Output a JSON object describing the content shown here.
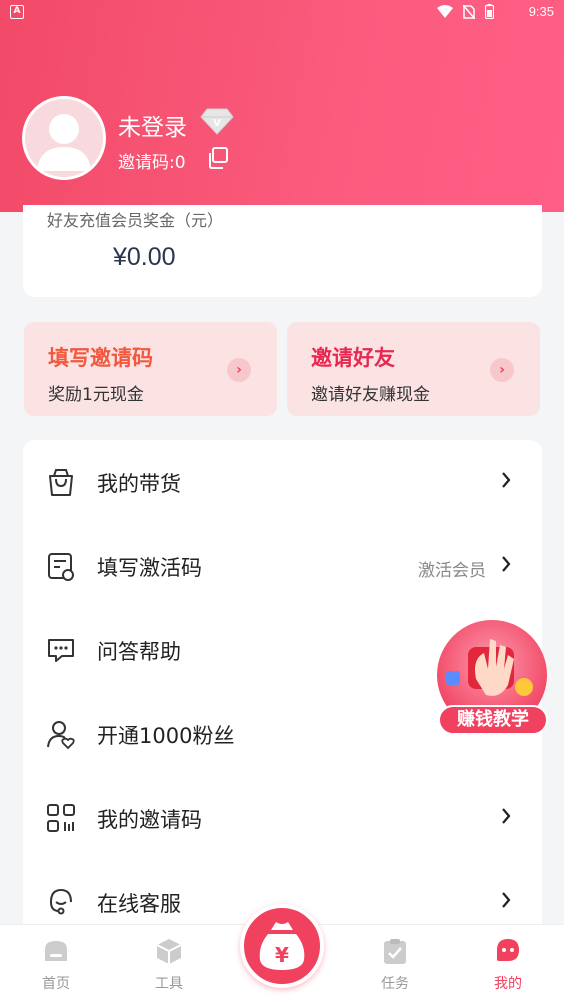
{
  "status_bar": {
    "time": "9:35",
    "app_badge": "A"
  },
  "profile": {
    "name": "未登录",
    "invite_code_label": "邀请码:0"
  },
  "earnings": {
    "label": "好友充值会员奖金（元）",
    "amount": "¥0.00"
  },
  "promos": [
    {
      "title": "填写邀请码",
      "subtitle": "奖励1元现金",
      "title_color": "#f2583e"
    },
    {
      "title": "邀请好友",
      "subtitle": "邀请好友赚现金",
      "title_color": "#e8284f"
    }
  ],
  "menu": [
    {
      "label": "我的带货",
      "icon": "shopping-bag-icon",
      "extra": ""
    },
    {
      "label": "填写激活码",
      "icon": "activation-form-icon",
      "extra": "激活会员"
    },
    {
      "label": "问答帮助",
      "icon": "chat-help-icon",
      "extra": ""
    },
    {
      "label": "开通1000粉丝",
      "icon": "user-heart-icon",
      "extra": ""
    },
    {
      "label": "我的邀请码",
      "icon": "qr-code-icon",
      "extra": ""
    },
    {
      "label": "在线客服",
      "icon": "customer-service-icon",
      "extra": ""
    }
  ],
  "floating_badge": {
    "label": "赚钱教学",
    "icon": "hand-gift-icon"
  },
  "tabs": [
    {
      "label": "首页",
      "icon": "home-icon",
      "active": false
    },
    {
      "label": "工具",
      "icon": "box-icon",
      "active": false
    },
    {
      "label": "任务",
      "icon": "clipboard-check-icon",
      "active": false
    },
    {
      "label": "我的",
      "icon": "profile-bubble-icon",
      "active": true
    }
  ],
  "center_tab": {
    "icon": "money-bag-icon",
    "symbol": "¥"
  },
  "colors": {
    "accent": "#f0415e",
    "header_start": "#f24a68",
    "header_end": "#ff5f86"
  }
}
